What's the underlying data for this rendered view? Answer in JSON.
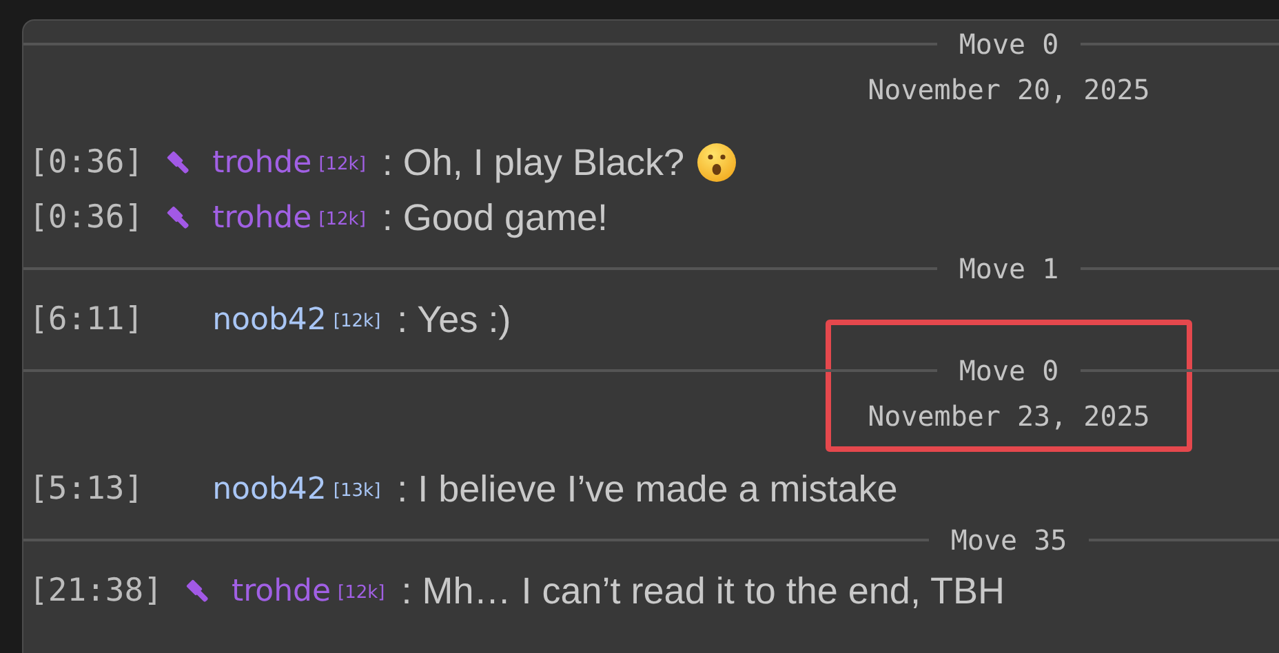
{
  "chat": [
    {
      "kind": "separator",
      "label": "Move 0",
      "date": "November 20, 2025",
      "highlighted": false
    },
    {
      "kind": "message",
      "time": "[0:36]",
      "moderator": true,
      "user": "trohde",
      "rank": "[12k]",
      "text": ": Oh, I play Black?",
      "emoji": true
    },
    {
      "kind": "message",
      "time": "[0:36]",
      "moderator": true,
      "user": "trohde",
      "rank": "[12k]",
      "text": ": Good game!",
      "emoji": false
    },
    {
      "kind": "separator",
      "label": "Move 1",
      "highlighted": false
    },
    {
      "kind": "message",
      "time": "[6:11]",
      "moderator": false,
      "user": "noob42",
      "rank": "[12k]",
      "text": ": Yes :)",
      "emoji": false
    },
    {
      "kind": "separator",
      "label": "Move 0",
      "date": "November 23, 2025",
      "highlighted": true
    },
    {
      "kind": "message",
      "time": "[5:13]",
      "moderator": false,
      "user": "noob42",
      "rank": "[13k]",
      "text": ": I believe I’ve made a mistake",
      "emoji": false
    },
    {
      "kind": "separator",
      "label": "Move 35",
      "highlighted": false
    },
    {
      "kind": "message",
      "time": "[21:38]",
      "moderator": true,
      "user": "trohde",
      "rank": "[12k]",
      "text": ": Mh… I can’t read it to the end, TBH",
      "emoji": false
    }
  ]
}
